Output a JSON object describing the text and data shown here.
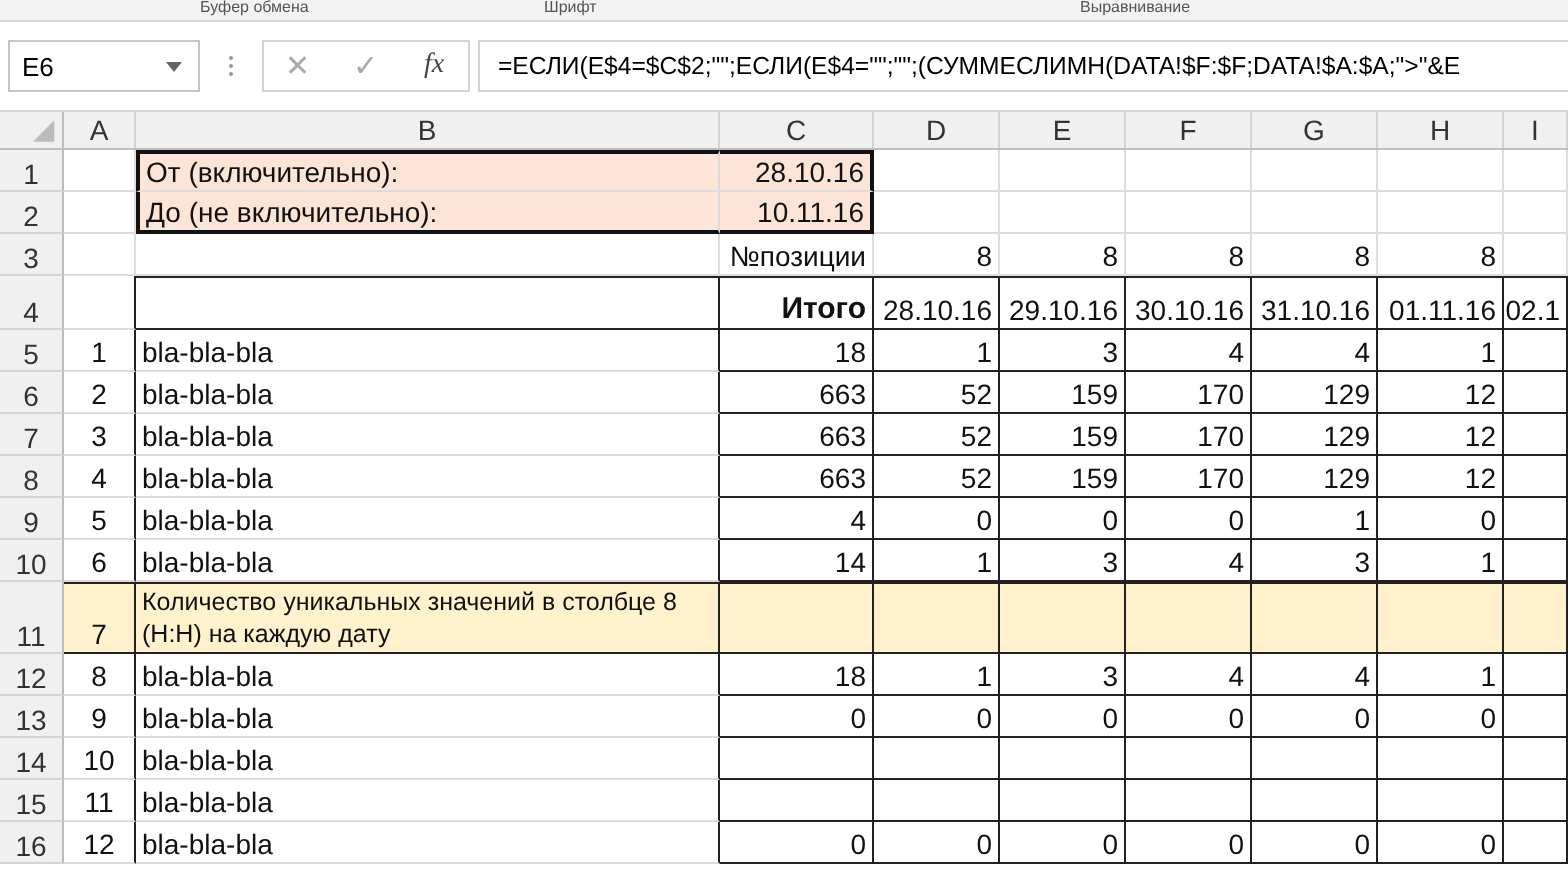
{
  "ribbon_groups": [
    "Буфер обмена",
    "Шрифт",
    "Выравнивание"
  ],
  "formula_bar": {
    "name_box": "E6",
    "cancel": "✕",
    "enter": "✓",
    "fx": "fx",
    "formula": "=ЕСЛИ(E$4=$C$2;\"\";ЕСЛИ(E$4=\"\";\"\";(СУММЕСЛИМН(DATA!$F:$F;DATA!$A:$A;\">\"&E"
  },
  "columns": [
    "A",
    "B",
    "C",
    "D",
    "E",
    "F",
    "G",
    "H",
    "I"
  ],
  "rows": [
    {
      "header": "1",
      "kind": "input",
      "cells": [
        "",
        "От (включительно):",
        "28.10.16",
        "",
        "",
        "",
        "",
        "",
        ""
      ]
    },
    {
      "header": "2",
      "kind": "input",
      "cells": [
        "",
        "До (не включительно):",
        "10.11.16",
        "",
        "",
        "",
        "",
        "",
        ""
      ]
    },
    {
      "header": "3",
      "kind": "plain",
      "cells": [
        "",
        "",
        "№позиции",
        "8",
        "8",
        "8",
        "8",
        "8",
        ""
      ]
    },
    {
      "header": "4",
      "kind": "heading",
      "cells": [
        "",
        "",
        "Итого",
        "28.10.16",
        "29.10.16",
        "30.10.16",
        "31.10.16",
        "01.11.16",
        "02.1"
      ]
    },
    {
      "header": "5",
      "kind": "data",
      "cells": [
        "1",
        "bla-bla-bla",
        "18",
        "1",
        "3",
        "4",
        "4",
        "1",
        ""
      ]
    },
    {
      "header": "6",
      "kind": "data",
      "cells": [
        "2",
        "bla-bla-bla",
        "663",
        "52",
        "159",
        "170",
        "129",
        "12",
        ""
      ]
    },
    {
      "header": "7",
      "kind": "data",
      "cells": [
        "3",
        "bla-bla-bla",
        "663",
        "52",
        "159",
        "170",
        "129",
        "12",
        ""
      ]
    },
    {
      "header": "8",
      "kind": "data",
      "cells": [
        "4",
        "bla-bla-bla",
        "663",
        "52",
        "159",
        "170",
        "129",
        "12",
        ""
      ]
    },
    {
      "header": "9",
      "kind": "data",
      "cells": [
        "5",
        "bla-bla-bla",
        "4",
        "0",
        "0",
        "0",
        "1",
        "0",
        ""
      ]
    },
    {
      "header": "10",
      "kind": "data",
      "cells": [
        "6",
        "bla-bla-bla",
        "14",
        "1",
        "3",
        "4",
        "3",
        "1",
        ""
      ]
    },
    {
      "header": "11",
      "kind": "note",
      "cells": [
        "7",
        "Количество уникальных значений в столбце 8 (H:H) на каждую дату",
        "",
        "",
        "",
        "",
        "",
        "",
        ""
      ]
    },
    {
      "header": "12",
      "kind": "data",
      "cells": [
        "8",
        "bla-bla-bla",
        "18",
        "1",
        "3",
        "4",
        "4",
        "1",
        ""
      ]
    },
    {
      "header": "13",
      "kind": "data",
      "cells": [
        "9",
        "bla-bla-bla",
        "0",
        "0",
        "0",
        "0",
        "0",
        "0",
        ""
      ]
    },
    {
      "header": "14",
      "kind": "data",
      "cells": [
        "10",
        "bla-bla-bla",
        "",
        "",
        "",
        "",
        "",
        "",
        ""
      ]
    },
    {
      "header": "15",
      "kind": "data",
      "cells": [
        "11",
        "bla-bla-bla",
        "",
        "",
        "",
        "",
        "",
        "",
        ""
      ]
    },
    {
      "header": "16",
      "kind": "data",
      "cells": [
        "12",
        "bla-bla-bla",
        "0",
        "0",
        "0",
        "0",
        "0",
        "0",
        ""
      ]
    }
  ]
}
